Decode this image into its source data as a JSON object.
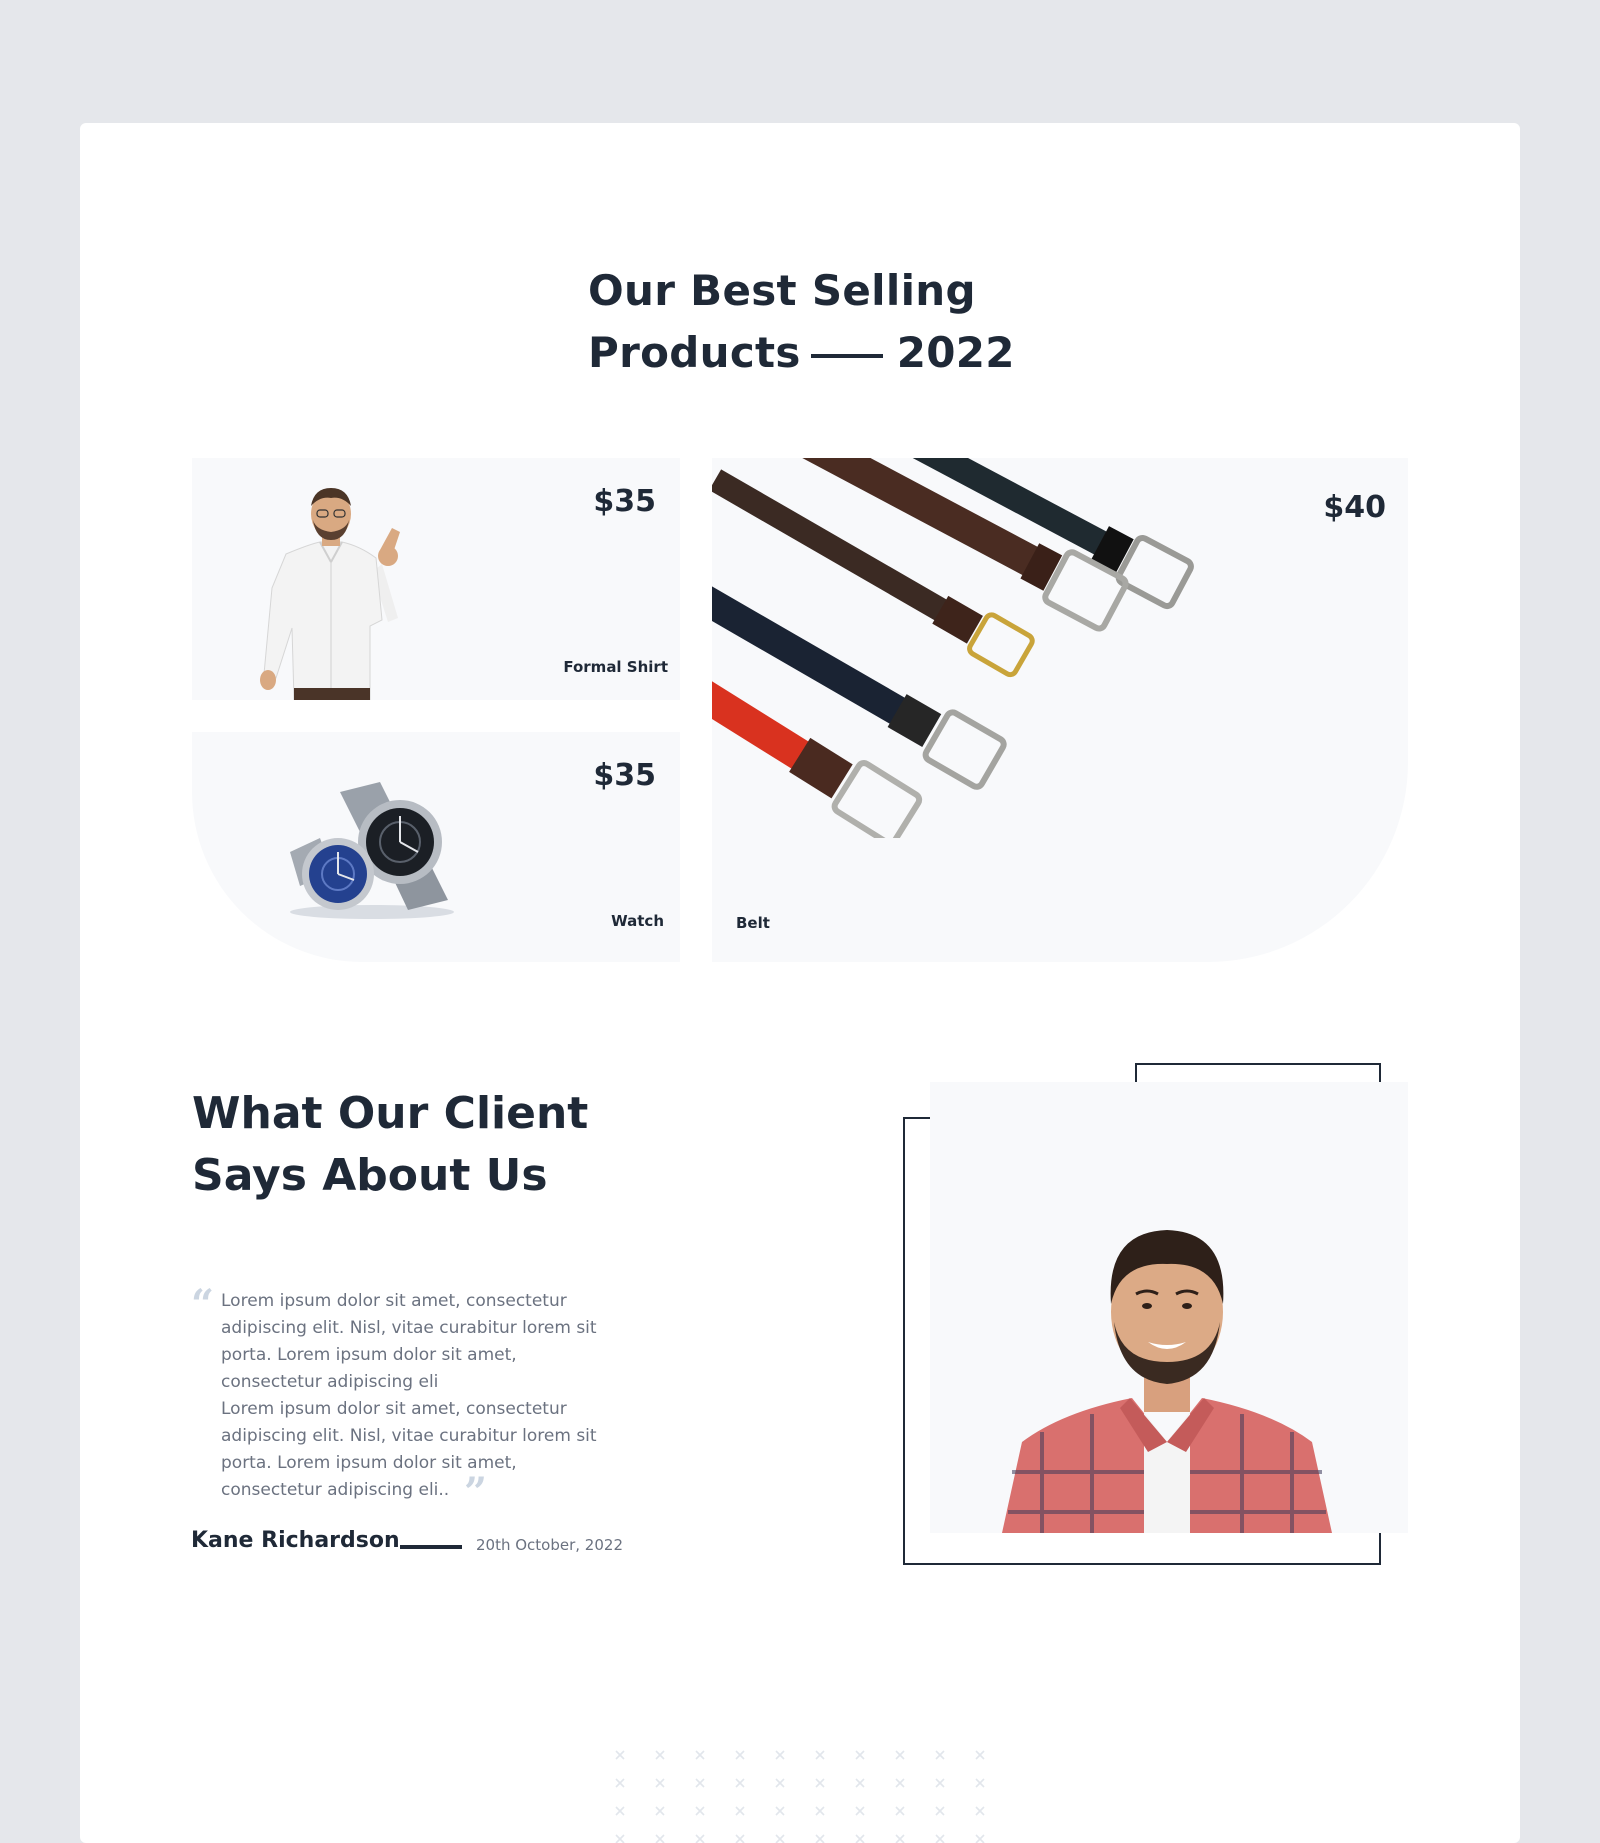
{
  "section_products": {
    "title_line1": "Our Best Selling",
    "title_line2": "Products",
    "title_year": "2022"
  },
  "products": [
    {
      "name": "Formal Shirt",
      "price": "$35",
      "image": "man-in-white-shirt"
    },
    {
      "name": "Watch",
      "price": "$35",
      "image": "two-wrist-watches"
    },
    {
      "name": "Belt",
      "price": "$40",
      "image": "five-leather-belts"
    }
  ],
  "testimonial": {
    "title_line1": "What Our Client",
    "title_line2": "Says About Us",
    "quote_lines": [
      "Lorem ipsum dolor sit amet, consectetur",
      "adipiscing elit. Nisl, vitae curabitur lorem sit",
      "porta. Lorem ipsum dolor sit amet,",
      "consectetur adipiscing eli",
      "Lorem ipsum dolor sit amet, consectetur",
      "adipiscing elit. Nisl, vitae curabitur lorem sit",
      "porta. Lorem ipsum dolor sit amet,",
      "consectetur adipiscing eli.."
    ],
    "author": "Kane Richardson",
    "date": "20th October, 2022",
    "image": "smiling-man-in-plaid-shirt"
  },
  "colors": {
    "page_bg": "#e5e7eb",
    "card_bg": "#ffffff",
    "tile_bg": "#f8f9fb",
    "text_dark": "#1f2937",
    "text_muted": "#6b7280",
    "quote_mark": "#cbd5e1"
  }
}
